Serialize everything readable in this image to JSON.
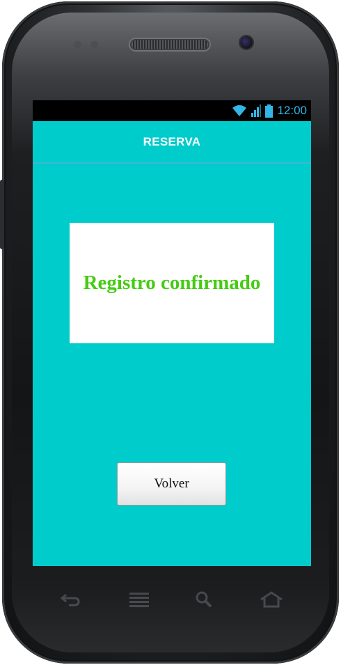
{
  "status_bar": {
    "time": "12:00",
    "icons": [
      "wifi-icon",
      "signal-icon",
      "battery-icon"
    ],
    "accent_color": "#33b5e5"
  },
  "action_bar": {
    "title": "RESERVA",
    "background_color": "#00cccc"
  },
  "main": {
    "message": "Registro confirmado",
    "message_color": "#44cc11",
    "back_button_label": "Volver"
  },
  "hardware_keys": [
    "back-icon",
    "menu-icon",
    "search-icon",
    "home-icon"
  ]
}
